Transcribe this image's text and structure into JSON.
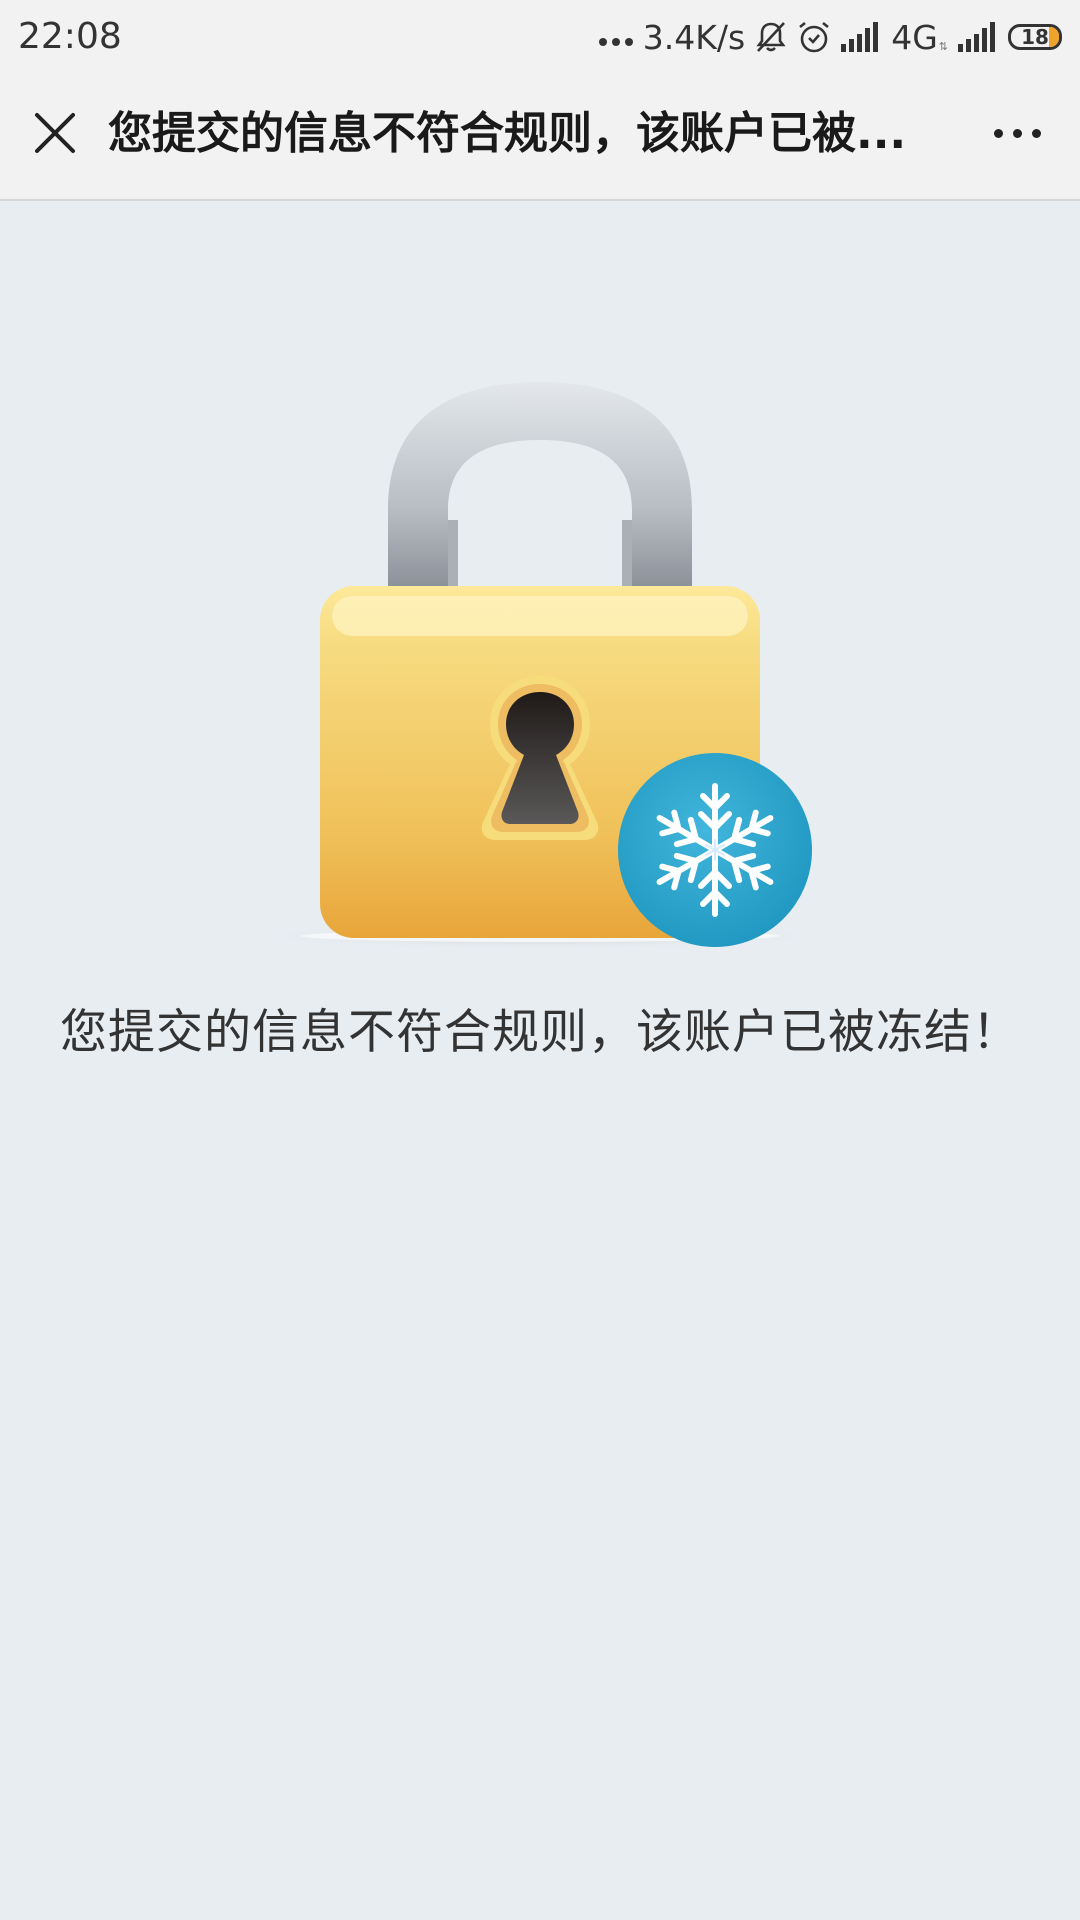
{
  "status_bar": {
    "time": "22:08",
    "network_speed": "3.4K/s",
    "network_type": "4G",
    "network_arrows": "⇅",
    "battery_level": "18",
    "icons": [
      "more-dots-icon",
      "mute-bell-icon",
      "alarm-icon",
      "signal-icon",
      "signal-icon-2",
      "battery-icon"
    ]
  },
  "title_bar": {
    "title": "您提交的信息不符合规则，该账户已被...",
    "close_icon": "close-icon",
    "more_icon": "more-icon"
  },
  "main": {
    "illustration": "frozen-lock-icon",
    "message": "您提交的信息不符合规则，该账户已被冻结！"
  },
  "colors": {
    "background": "#e8edf2",
    "bar_background": "#f2f2f2",
    "lock_body": "#f3c14a",
    "snow_badge": "#2ea7cf"
  }
}
